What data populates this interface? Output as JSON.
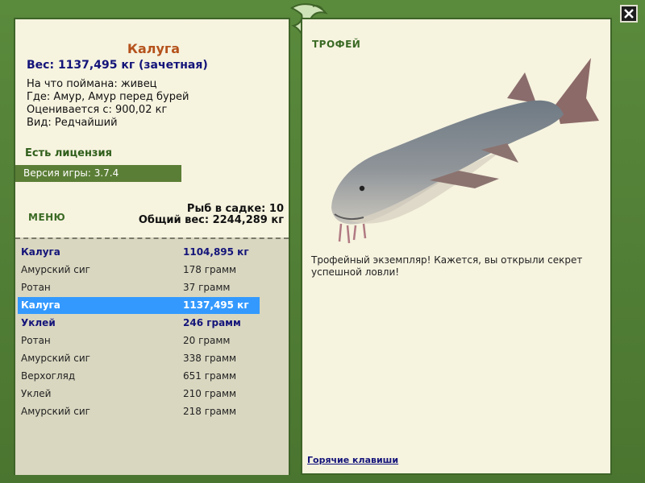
{
  "fish": {
    "title": "Калуга",
    "weight": "Вес: 1137,495 кг (зачетная)",
    "caught_on": "На что поймана: живец",
    "where": "Где: Амур, Амур перед бурей",
    "valued_from": "Оценивается с: 900,02 кг",
    "kind": "Вид: Редчайший"
  },
  "license": "Есть лицензия",
  "version": "Версия игры: 3.7.4",
  "menu_label": "МЕНЮ",
  "stats": {
    "count": "Рыб в садке: 10",
    "total": "Общий вес: 2244,289 кг"
  },
  "catch_list": [
    {
      "name": "Калуга",
      "weight": "1104,895 кг",
      "style": "bold"
    },
    {
      "name": "Амурский сиг",
      "weight": "178 грамм",
      "style": "normal"
    },
    {
      "name": "Ротан",
      "weight": "37 грамм",
      "style": "normal"
    },
    {
      "name": "Калуга",
      "weight": "1137,495 кг",
      "style": "selected"
    },
    {
      "name": "Уклей",
      "weight": "246 грамм",
      "style": "bold"
    },
    {
      "name": "Ротан",
      "weight": "20 грамм",
      "style": "normal"
    },
    {
      "name": "Амурский сиг",
      "weight": "338 грамм",
      "style": "normal"
    },
    {
      "name": "Верхогляд",
      "weight": "651 грамм",
      "style": "normal"
    },
    {
      "name": "Уклей",
      "weight": "210 грамм",
      "style": "normal"
    },
    {
      "name": "Амурский сиг",
      "weight": "218 грамм",
      "style": "normal"
    }
  ],
  "trophy": {
    "label": "ТРОФЕЙ",
    "description": "Трофейный экземпляр! Кажется, вы открыли секрет успешной ловли!",
    "hotkeys": "Горячие клавиши"
  },
  "colors": {
    "frame": "#4f7a34",
    "panel": "#f6f3df",
    "list_bg": "#d9d7c0",
    "selected": "#3399ff",
    "title": "#b5521b",
    "navy": "#14147a"
  }
}
